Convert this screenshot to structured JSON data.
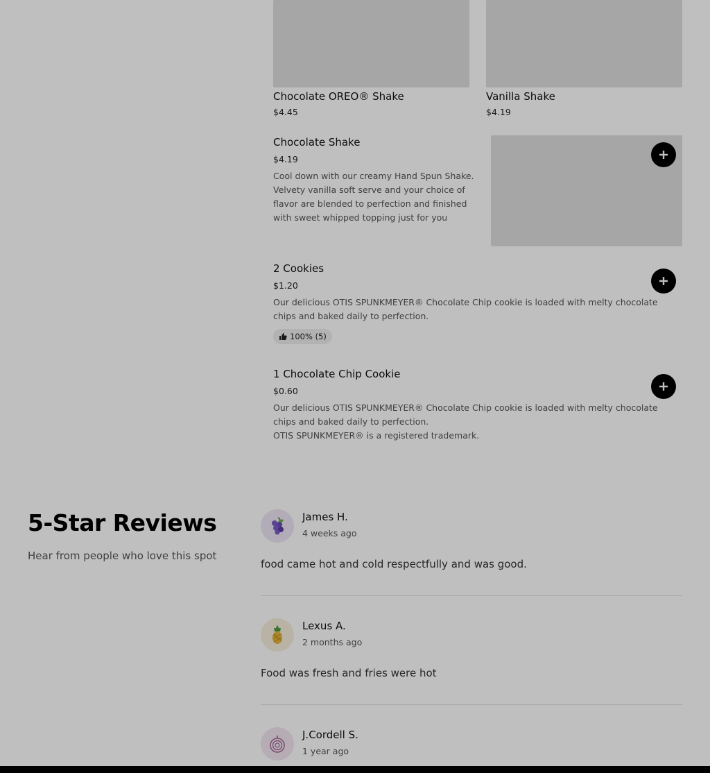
{
  "menu": {
    "top_items": [
      {
        "name": "Chocolate OREO® Shake",
        "price": "$4.45"
      },
      {
        "name": "Vanilla Shake",
        "price": "$4.19"
      }
    ],
    "items": [
      {
        "name": "Chocolate Shake",
        "price": "$4.19",
        "description": "Cool down with our creamy Hand Spun Shake. Velvety vanilla soft serve and your choice of flavor are blended to perfection and finished with sweet whipped topping just for you"
      },
      {
        "name": "2 Cookies",
        "price": "$1.20",
        "description": "Our delicious OTIS SPUNKMEYER® Chocolate Chip cookie is loaded with melty chocolate chips and baked daily to perfection.",
        "rating": "100% (5)"
      },
      {
        "name": "1 Chocolate Chip Cookie",
        "price": "$0.60",
        "description": "Our delicious OTIS SPUNKMEYER® Chocolate Chip cookie is loaded with melty chocolate chips and baked daily to perfection.",
        "note": "OTIS SPUNKMEYER® is a registered trademark."
      }
    ]
  },
  "reviews": {
    "title": "5-Star Reviews",
    "subtitle": "Hear from people who love this spot",
    "list": [
      {
        "name": "James H.",
        "time": "4 weeks ago",
        "text": "food came hot and cold respectfully and was good.",
        "avatar_icon": "grapes-icon"
      },
      {
        "name": "Lexus A.",
        "time": "2 months ago",
        "text": "Food was fresh and fries were hot",
        "avatar_icon": "pineapple-icon"
      },
      {
        "name": "J.Cordell S.",
        "time": "1 year ago",
        "text": "",
        "avatar_icon": "onion-icon"
      }
    ]
  },
  "colors": {
    "overlay": "rgba(0,0,0,0.25)",
    "add_button": "#000000",
    "tile": "#dedede"
  }
}
